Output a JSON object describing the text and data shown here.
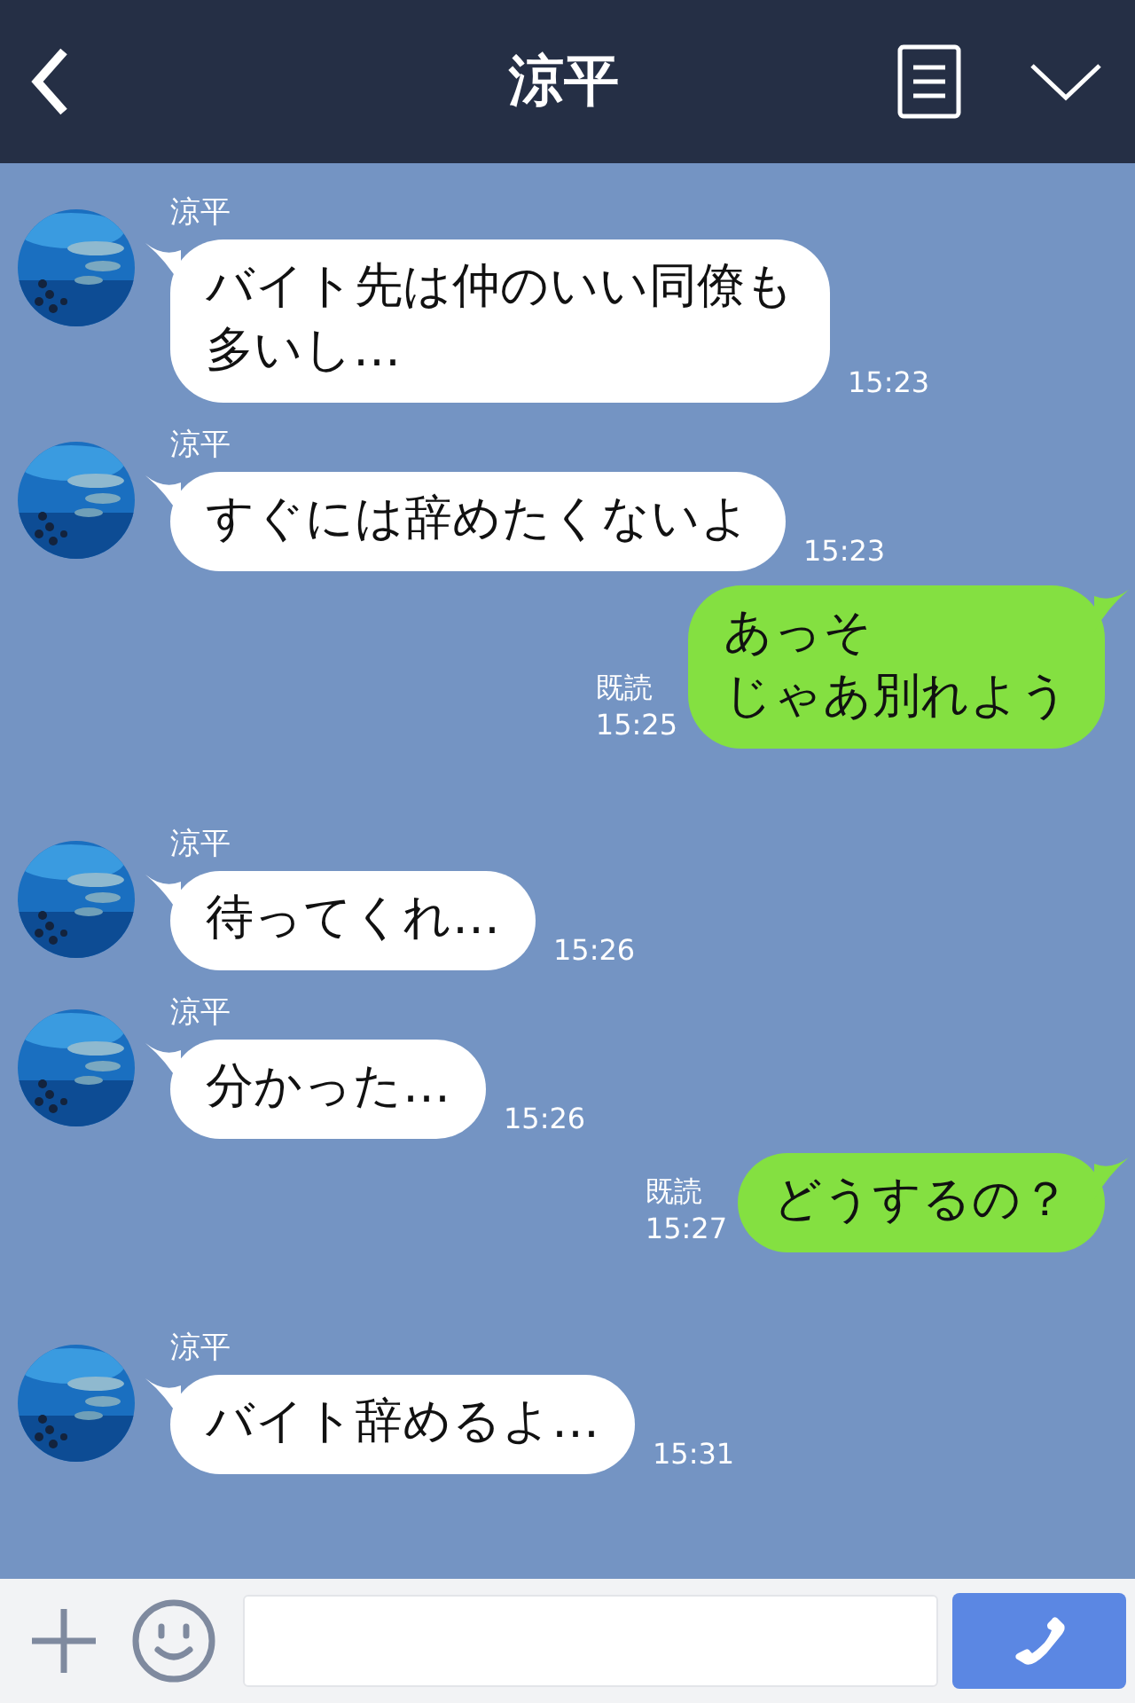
{
  "header": {
    "title": "涼平"
  },
  "messages": [
    {
      "kind": "received",
      "sender": "涼平",
      "lines": [
        "バイト先は仲のいい同僚も",
        "多いし…"
      ],
      "time": "15:23"
    },
    {
      "kind": "received",
      "sender": "涼平",
      "lines": [
        "すぐには辞めたくないよ"
      ],
      "time": "15:23"
    },
    {
      "kind": "sent",
      "read": "既読",
      "lines": [
        "あっそ",
        "じゃあ別れよう"
      ],
      "time": "15:25"
    },
    {
      "kind": "received",
      "sender": "涼平",
      "lines": [
        "待ってくれ…"
      ],
      "time": "15:26"
    },
    {
      "kind": "received",
      "sender": "涼平",
      "lines": [
        "分かった…"
      ],
      "time": "15:26"
    },
    {
      "kind": "sent",
      "read": "既読",
      "lines": [
        "どうするの？"
      ],
      "time": "15:27"
    },
    {
      "kind": "received",
      "sender": "涼平",
      "lines": [
        "バイト辞めるよ…"
      ],
      "time": "15:31"
    }
  ]
}
